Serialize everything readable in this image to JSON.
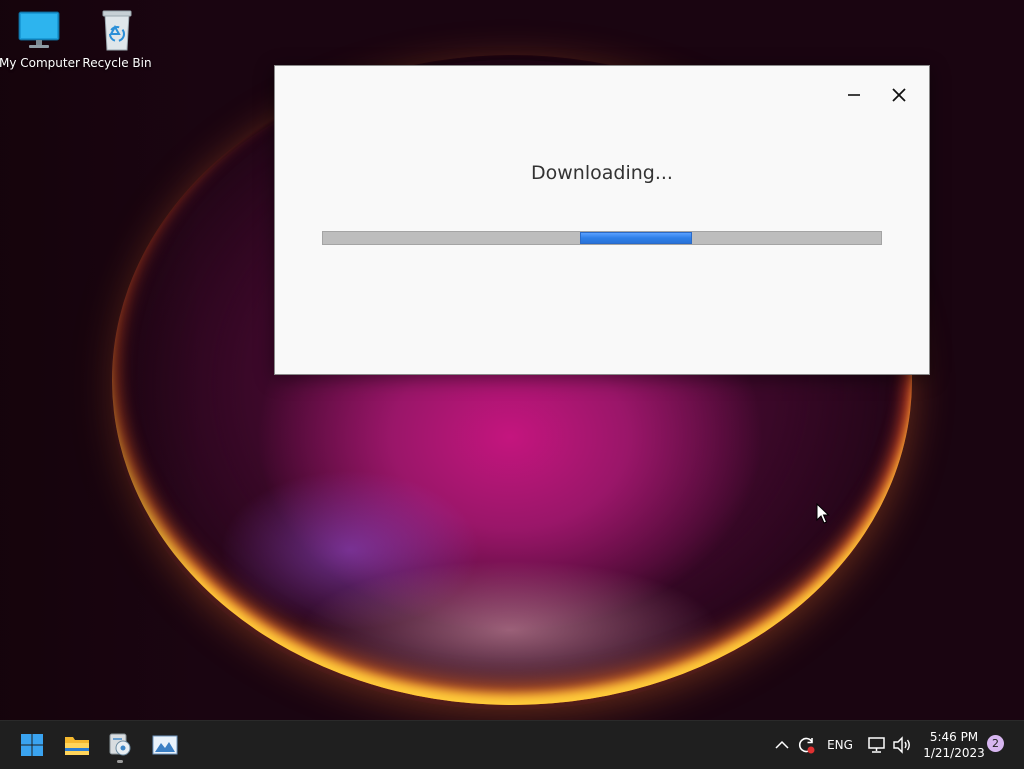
{
  "desktop": {
    "icons": [
      {
        "label": "My Computer",
        "icon": "monitor-icon"
      },
      {
        "label": "Recycle Bin",
        "icon": "recycle-bin-icon"
      }
    ]
  },
  "dialog": {
    "status_text": "Downloading...",
    "progress": {
      "mode": "indeterminate",
      "chunk_start_fraction": 0.46,
      "chunk_width_fraction": 0.2,
      "track_color": "#bdbdbd",
      "chunk_color": "#2f7fe8"
    },
    "buttons": {
      "minimize": "minimize-icon",
      "close": "close-icon"
    }
  },
  "taskbar": {
    "apps": [
      {
        "name": "Start",
        "icon": "windows-start-icon"
      },
      {
        "name": "File Explorer",
        "icon": "folder-icon"
      },
      {
        "name": "Installer",
        "icon": "installer-icon",
        "running": true
      },
      {
        "name": "Image Viewer",
        "icon": "image-icon"
      }
    ],
    "tray": {
      "chevron_icon": "chevron-up-icon",
      "sync_icon": "sync-icon",
      "language": "ENG",
      "network_icon": "network-icon",
      "volume_icon": "volume-icon",
      "time": "5:46 PM",
      "date": "1/21/2023",
      "notification_count": "2"
    }
  },
  "colors": {
    "accent": "#2f7fe8",
    "taskbar_bg": "#1f1f1f",
    "dialog_bg": "#f9f9f9"
  }
}
